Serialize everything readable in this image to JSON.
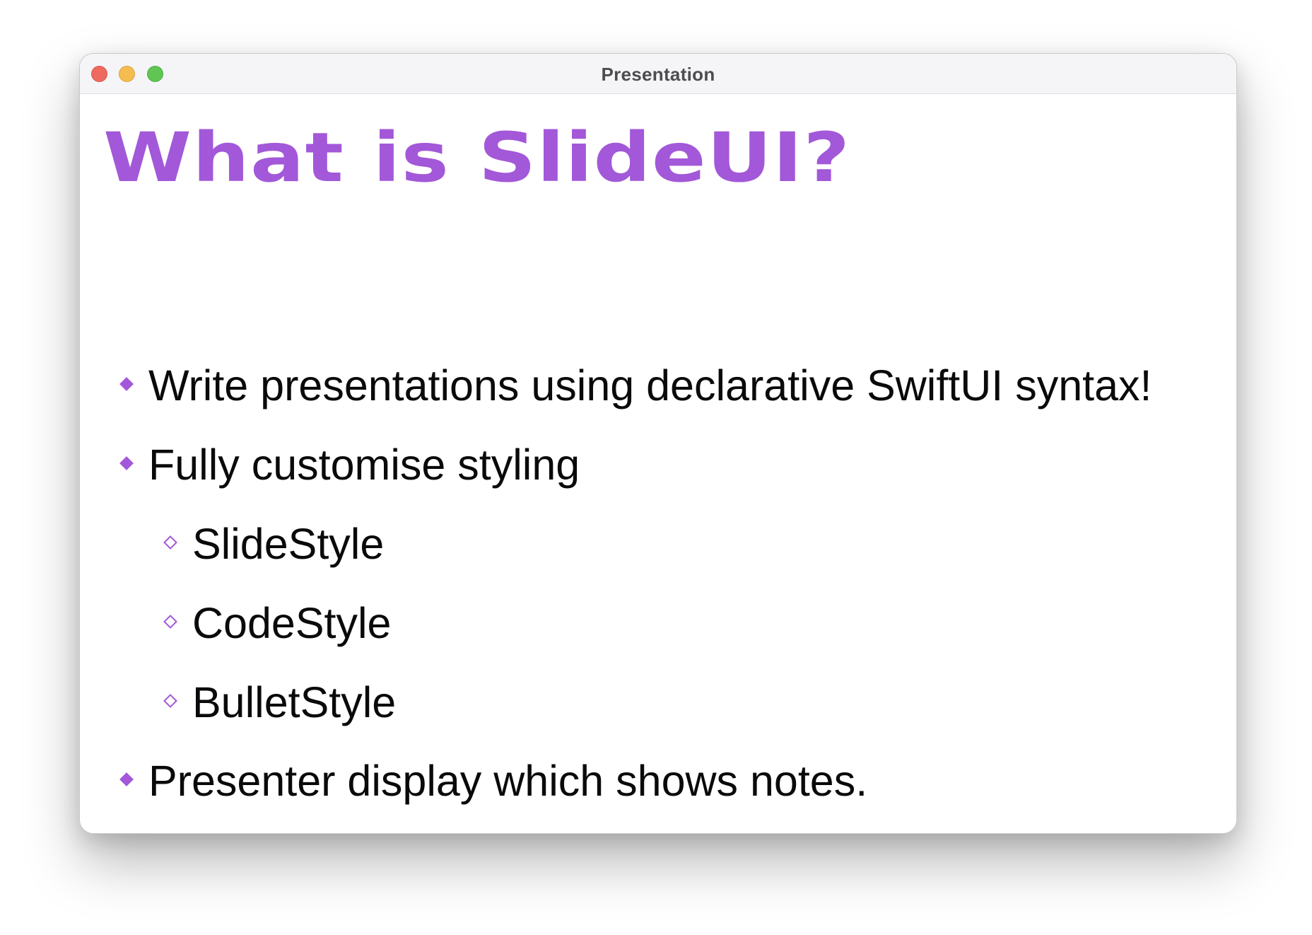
{
  "window": {
    "title": "Presentation",
    "controls": [
      "close",
      "minimize",
      "zoom"
    ]
  },
  "slide": {
    "title": "What is SlideUI?",
    "accent_color": "#a258d8",
    "bullets": [
      {
        "text": "Write presentations using declarative SwiftUI syntax!",
        "level": 1
      },
      {
        "text": "Fully customise styling",
        "level": 1
      },
      {
        "text": "SlideStyle",
        "level": 2
      },
      {
        "text": "CodeStyle",
        "level": 2
      },
      {
        "text": "BulletStyle",
        "level": 2
      },
      {
        "text": "Presenter display which shows notes.",
        "level": 1
      }
    ]
  }
}
